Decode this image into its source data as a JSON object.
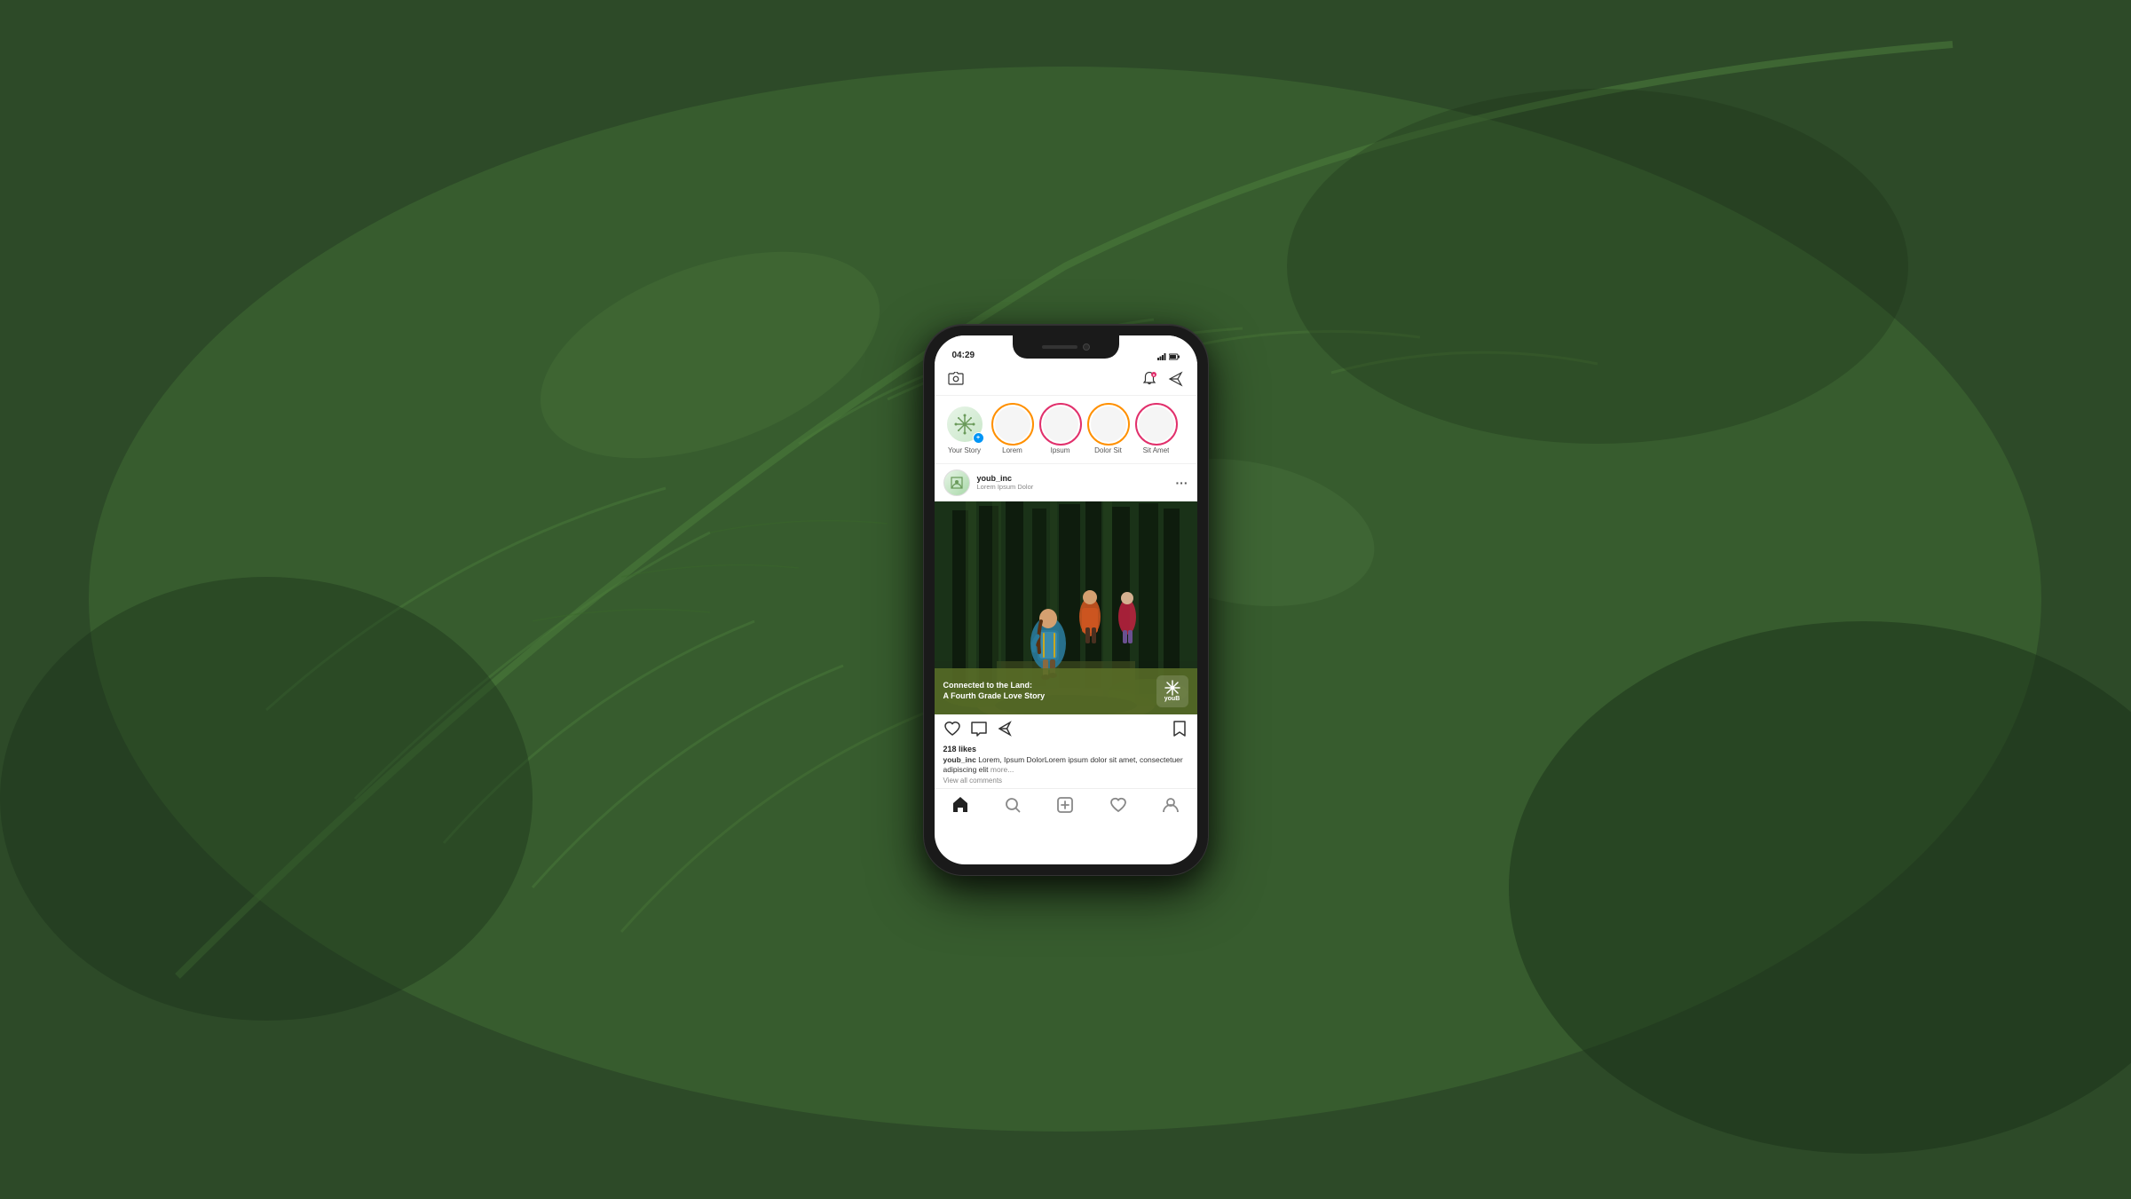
{
  "background": {
    "color": "#3a5a3a",
    "description": "green leaf macro photography background"
  },
  "phone": {
    "status_bar": {
      "time": "04:29",
      "signal_icon": "signal",
      "battery_icon": "battery"
    },
    "top_bar": {
      "camera_icon": "camera",
      "notification_icon": "notification-heart",
      "send_icon": "send"
    },
    "stories": [
      {
        "id": "your-story",
        "label": "Your Story",
        "has_ring": false,
        "has_add_badge": true,
        "is_own": true
      },
      {
        "id": "lorem",
        "label": "Lorem",
        "has_ring": true,
        "ring_color": "orange",
        "has_add_badge": false
      },
      {
        "id": "ipsum",
        "label": "Ipsum",
        "has_ring": true,
        "ring_color": "pink",
        "has_add_badge": false
      },
      {
        "id": "dolor-sit",
        "label": "Dolor Sit",
        "has_ring": true,
        "ring_color": "orange",
        "has_add_badge": false
      },
      {
        "id": "sit-amet",
        "label": "Sit Amet",
        "has_ring": true,
        "ring_color": "pink",
        "has_add_badge": false
      }
    ],
    "post": {
      "username": "youb_inc",
      "subtitle": "Lorem Ipsum Dolor",
      "image_caption": "Connected to the Land:\nA Fourth Grade Love Story",
      "logo_text": "youB",
      "likes": "218 likes",
      "caption_username": "youb_inc",
      "caption_text": "Lorem, Ipsum DolorLorem ipsum dolor sit amet, consectetuer adipiscing elit",
      "more_text": "more...",
      "view_comments": "View all comments"
    },
    "bottom_nav": {
      "items": [
        {
          "id": "home",
          "icon": "home",
          "active": true
        },
        {
          "id": "search",
          "icon": "search",
          "active": false
        },
        {
          "id": "add",
          "icon": "add-square",
          "active": false
        },
        {
          "id": "heart",
          "icon": "heart",
          "active": false
        },
        {
          "id": "profile",
          "icon": "profile",
          "active": false
        }
      ]
    }
  }
}
